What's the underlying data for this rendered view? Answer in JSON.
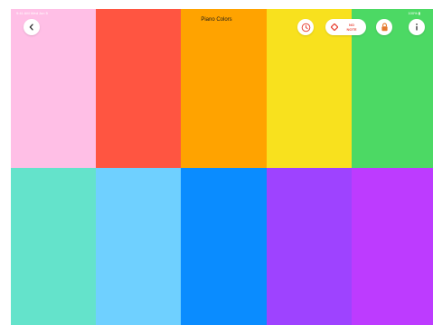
{
  "status_bar": {
    "left": "9:41 AM  Wed Jun 5",
    "right": "100% ▮"
  },
  "header": {
    "title": "Piano Colors"
  },
  "toolbar": {
    "notes_line1": "NO",
    "notes_line2": "NOTE"
  },
  "keys": {
    "top_row": [
      "#FFBFE6",
      "#FF5541",
      "#FFA300",
      "#F8E11E",
      "#4CD964"
    ],
    "bottom_row": [
      "#64E3CB",
      "#6FD0FF",
      "#0A8CFF",
      "#9E43FF",
      "#BD3BFF"
    ]
  },
  "colors": {
    "accent_red": "#E8493B",
    "lock_orange": "#E57A2E",
    "icon_dark": "#3A3A3C"
  },
  "icons": [
    "chevron-left-icon",
    "timer-icon",
    "note-diamond-icon",
    "lock-icon",
    "info-icon"
  ]
}
